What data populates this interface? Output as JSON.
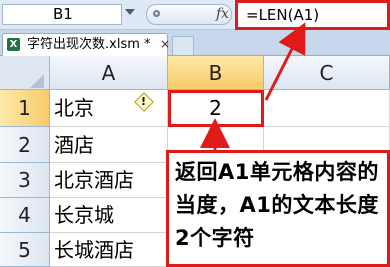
{
  "formula_bar": {
    "name_box": "B1",
    "fx_label": "fx",
    "formula": "=LEN(A1)"
  },
  "file_tab": {
    "name": "字符出现次数.xlsm *",
    "icon_letter": "X",
    "close": "×"
  },
  "grid": {
    "columns": [
      "A",
      "B",
      "C"
    ],
    "rows": [
      {
        "num": "1",
        "a": "北京",
        "b": "2"
      },
      {
        "num": "2",
        "a": "酒店",
        "b": ""
      },
      {
        "num": "3",
        "a": "北京酒店",
        "b": ""
      },
      {
        "num": "4",
        "a": "长京城",
        "b": ""
      },
      {
        "num": "5",
        "a": "长城酒店",
        "b": ""
      }
    ],
    "selected_cell": "B1",
    "warning_icon": "!"
  },
  "annotation": {
    "text": "返回A1单元格内容的当度，A1的文本长度2个字符"
  },
  "colors": {
    "highlight_red": "#e01919",
    "header_selected": "#f8cb6b"
  }
}
